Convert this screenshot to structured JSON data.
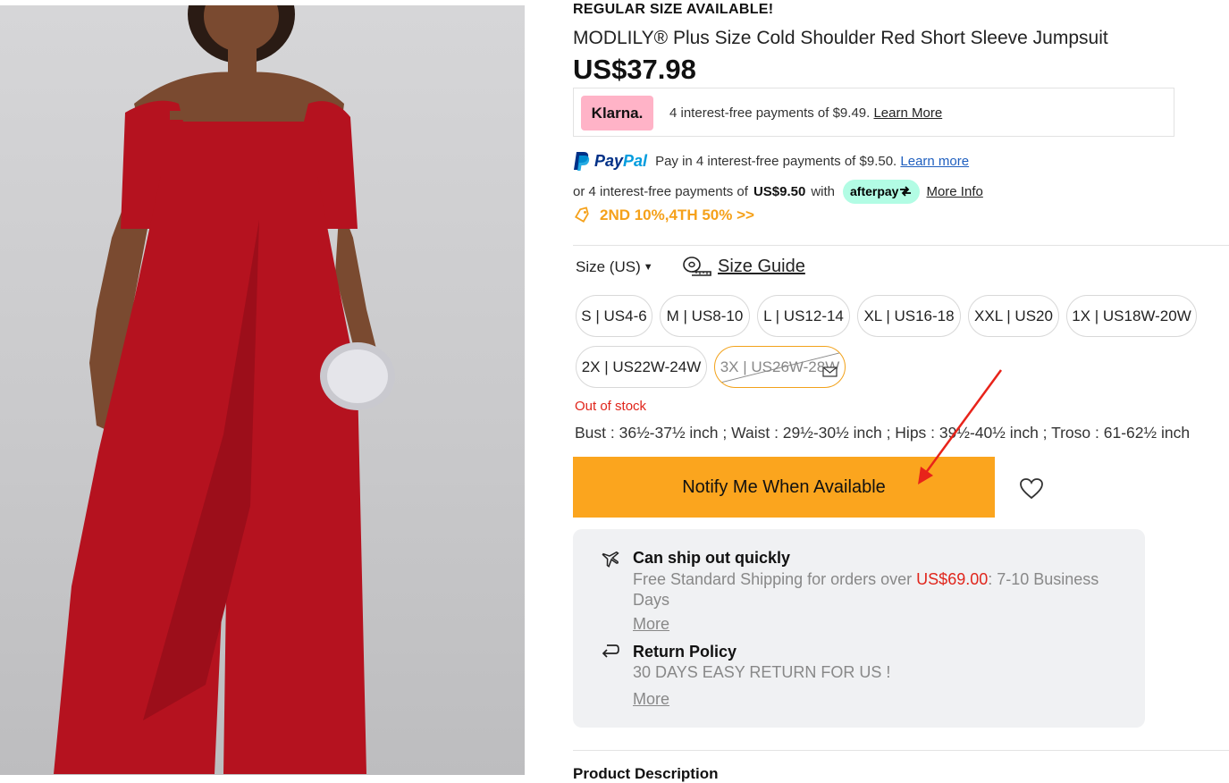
{
  "product": {
    "banner": "REGULAR SIZE AVAILABLE!",
    "title": "MODLILY® Plus Size Cold Shoulder Red Short Sleeve Jumpsuit",
    "price": "US$37.98"
  },
  "klarna": {
    "logo": "Klarna.",
    "text": "4 interest-free payments of $9.49.",
    "link": "Learn More"
  },
  "paypal": {
    "logo_word_1": "Pay",
    "logo_word_2": "Pal",
    "text": "Pay in 4 interest-free payments of $9.50.",
    "link": "Learn more"
  },
  "afterpay": {
    "text_prefix": "or 4 interest-free payments of",
    "amount": "US$9.50",
    "text_with": "with",
    "badge": "afterpay",
    "link": "More Info"
  },
  "promo": {
    "text": "2ND 10%,4TH 50% >>",
    "color": "#f5a11a"
  },
  "size": {
    "label": "Size (US)",
    "guide": "Size Guide",
    "options": [
      "S | US4-6",
      "M | US8-10",
      "L | US12-14",
      "XL | US16-18",
      "XXL | US20",
      "1X | US18W-20W",
      "2X | US22W-24W",
      "3X | US26W-28W"
    ],
    "out_of_stock": "Out of stock",
    "measurements": "Bust : 36½-37½ inch ; Waist : 29½-30½ inch ; Hips : 39½-40½ inch ; Troso : 61-62½ inch"
  },
  "actions": {
    "notify": "Notify Me When Available",
    "notify_color": "#fba51e"
  },
  "shipping": {
    "title": "Can ship out quickly",
    "text_prefix": "Free Standard Shipping for orders over ",
    "threshold": "US$69.00",
    "text_suffix": ": 7-10 Business Days",
    "more": "More"
  },
  "returns": {
    "title": "Return Policy",
    "text": "30 DAYS EASY RETURN FOR US !",
    "more": "More"
  },
  "description": {
    "heading": "Product Description"
  }
}
